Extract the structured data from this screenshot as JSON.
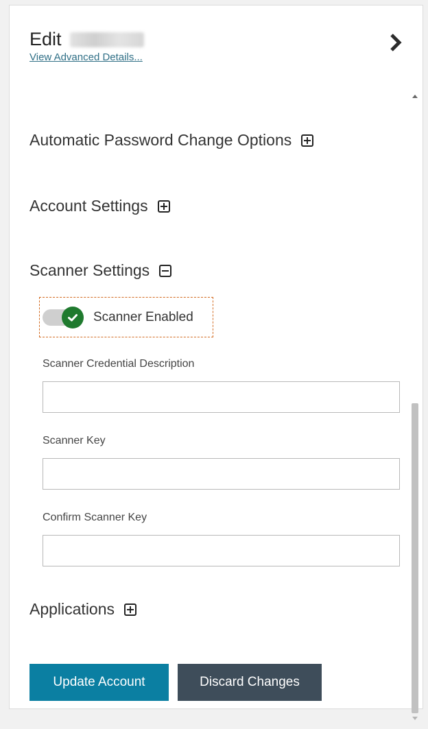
{
  "header": {
    "title": "Edit",
    "advanced_link": "View Advanced Details..."
  },
  "sections": [
    {
      "label": "Automatic Password Change Options",
      "state": "collapsed"
    },
    {
      "label": "Account Settings",
      "state": "collapsed"
    },
    {
      "label": "Scanner Settings",
      "state": "expanded"
    },
    {
      "label": "Applications",
      "state": "collapsed"
    }
  ],
  "scanner": {
    "enabled_label": "Scanner Enabled",
    "enabled": true,
    "fields": [
      {
        "label": "Scanner Credential Description",
        "value": "",
        "placeholder": ""
      },
      {
        "label": "Scanner Key",
        "value": "",
        "placeholder": ""
      },
      {
        "label": "Confirm Scanner Key",
        "value": "",
        "placeholder": ""
      }
    ]
  },
  "actions": {
    "update_label": "Update Account",
    "discard_label": "Discard Changes"
  },
  "colors": {
    "primary_button": "#0b7fa2",
    "secondary_button": "#3e4d5a",
    "toggle_on": "#1f7a2e",
    "link": "#2f6f86"
  },
  "icons": {
    "close_panel": "chevron-right-icon",
    "expand": "plus-square-icon",
    "collapse": "minus-square-icon",
    "toggle_check": "check-icon"
  }
}
